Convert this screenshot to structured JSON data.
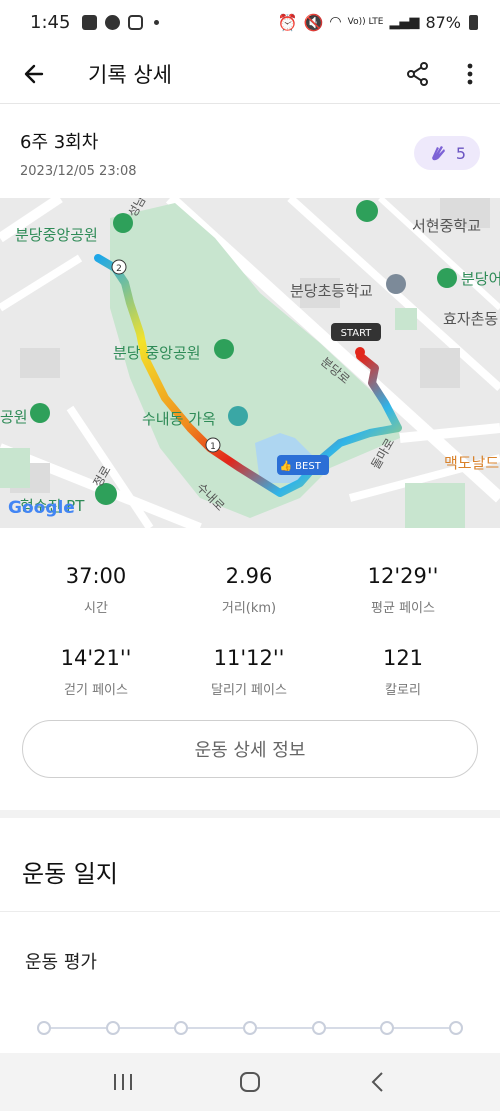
{
  "status_bar": {
    "time": "1:45",
    "battery": "87%",
    "network_label": "Vo)) LTE"
  },
  "app_bar": {
    "title": "기록 상세",
    "back_icon": "arrow-left-icon",
    "share_icon": "share-icon",
    "more_icon": "more-vertical-icon"
  },
  "record": {
    "title": "6주 3회차",
    "date": "2023/12/05 23:08",
    "badge_icon": "clap-icon",
    "badge_count": "5"
  },
  "map": {
    "labels": {
      "park_top": "분당중앙공원",
      "road_top": "성남대로",
      "school_1": "서현중학교",
      "school_2": "분당초등학교",
      "apt_right": "분당어",
      "dong": "효자촌동",
      "road_right": "분당로",
      "park_center": "분당 중앙공원",
      "house": "수내동 가옥",
      "park_left": "공원",
      "road_bottom": "수내로",
      "road_center": "돌마로",
      "mcd": "맥도날드",
      "pt": "형수진 PT",
      "road_left": "정로",
      "logo": "Google",
      "marker_start": "START",
      "marker_best": "BEST",
      "marker_1": "1",
      "marker_2": "2"
    },
    "colors": {
      "park": "#c8e5cf",
      "route_fast": "#1ea7e8",
      "route_mid": "#f3e22a",
      "route_slow": "#e2261b",
      "best_badge": "#2b6fd6"
    }
  },
  "stats": [
    {
      "value": "37:00",
      "label": "시간"
    },
    {
      "value": "2.96",
      "label": "거리(km)"
    },
    {
      "value": "12'29''",
      "label": "평균 페이스"
    },
    {
      "value": "14'21''",
      "label": "걷기 페이스"
    },
    {
      "value": "11'12''",
      "label": "달리기 페이스"
    },
    {
      "value": "121",
      "label": "칼로리"
    }
  ],
  "detail_button": "운동 상세 정보",
  "log_section": {
    "title": "운동 일지",
    "evaluation_title": "운동 평가",
    "rating_points": 7
  },
  "nav": {
    "recent_icon": "recent-apps-icon",
    "home_icon": "home-icon",
    "back_icon": "nav-back-icon"
  }
}
